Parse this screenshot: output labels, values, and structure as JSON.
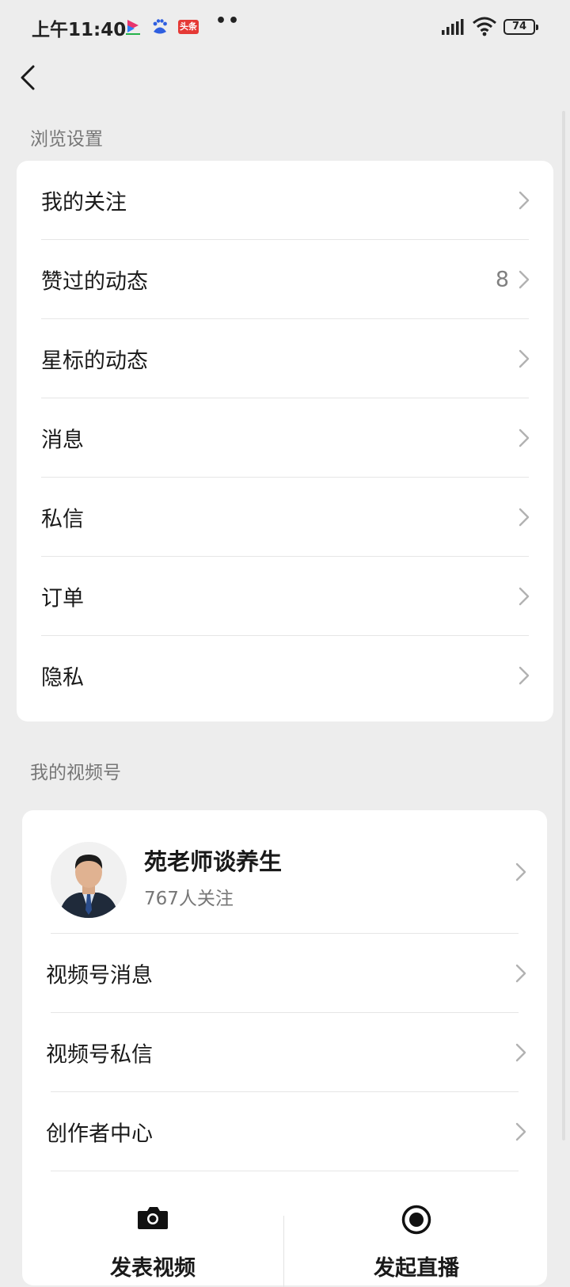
{
  "status_bar": {
    "time": "上午11:40",
    "dots": "••",
    "battery": "74",
    "notification_icons": [
      "app-icon-1",
      "baidu-icon",
      "toutiao-icon"
    ],
    "toutiao_text": "头条"
  },
  "nav": {
    "back_icon": "chevron-left-icon"
  },
  "browse_section": {
    "label": "浏览设置",
    "items": [
      {
        "label": "我的关注",
        "count": ""
      },
      {
        "label": "赞过的动态",
        "count": "8"
      },
      {
        "label": "星标的动态",
        "count": ""
      },
      {
        "label": "消息",
        "count": ""
      },
      {
        "label": "私信",
        "count": ""
      },
      {
        "label": "订单",
        "count": ""
      },
      {
        "label": "隐私",
        "count": ""
      }
    ]
  },
  "video_section": {
    "label": "我的视频号",
    "profile": {
      "name": "苑老师谈养生",
      "followers": "767人关注"
    },
    "items": [
      {
        "label": "视频号消息"
      },
      {
        "label": "视频号私信"
      },
      {
        "label": "创作者中心"
      }
    ],
    "actions": [
      {
        "label": "发表视频",
        "icon": "camera-icon"
      },
      {
        "label": "发起直播",
        "icon": "live-record-icon"
      }
    ]
  },
  "colors": {
    "background": "#ededed",
    "card": "#ffffff",
    "secondary_text": "#777777",
    "chevron": "#b2b2b2"
  }
}
